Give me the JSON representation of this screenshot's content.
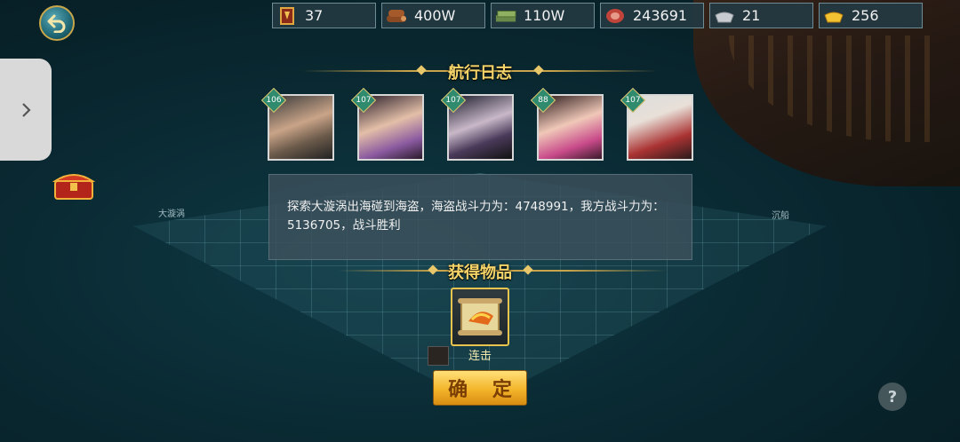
{
  "resources": [
    {
      "icon": "medal-icon",
      "value": "37"
    },
    {
      "icon": "wood-icon",
      "value": "400W"
    },
    {
      "icon": "cash-icon",
      "value": "110W"
    },
    {
      "icon": "meat-icon",
      "value": "243691"
    },
    {
      "icon": "silver-icon",
      "value": "21"
    },
    {
      "icon": "gold-ingot-icon",
      "value": "256"
    }
  ],
  "log": {
    "title": "航行日志",
    "heroes": [
      {
        "level": "106"
      },
      {
        "level": "107"
      },
      {
        "level": "107"
      },
      {
        "level": "88"
      },
      {
        "level": "107"
      }
    ],
    "message": "探索大漩涡出海碰到海盗，海盗战斗力为：4748991，我方战斗力为：5136705，战斗胜利"
  },
  "rewards": {
    "title": "获得物品",
    "item_name": "连击"
  },
  "confirm_label": "确 定",
  "help_label": "?",
  "map_labels": {
    "whirlpool": "大漩涡",
    "wreck": "沉船"
  },
  "colors": {
    "gold_text": "#f5d46a",
    "confirm_button": "#f3b52a"
  }
}
